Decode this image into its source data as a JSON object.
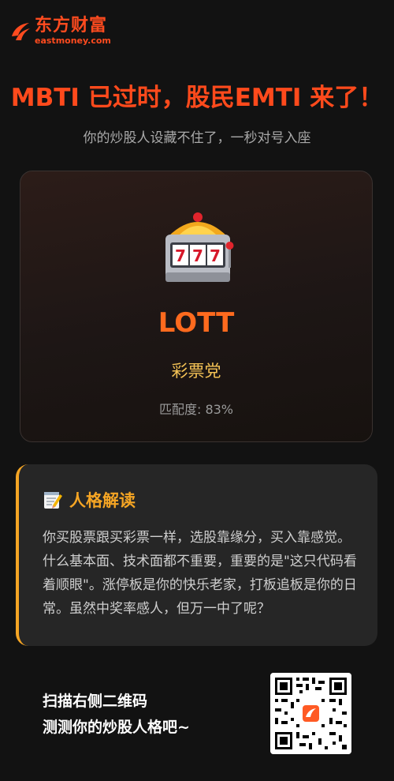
{
  "brand": {
    "name_cn": "东方财富",
    "name_en": "eastmoney.com",
    "color": "#ff4b1f"
  },
  "header": {
    "headline": "MBTI 已过时，股民EMTI 来了！",
    "subtitle": "你的炒股人设藏不住了，一秒对号入座"
  },
  "result": {
    "icon": "slot-machine-icon",
    "code": "LOTT",
    "name": "彩票党",
    "match_label": "匹配度: 83%",
    "match_value": 83
  },
  "analysis": {
    "icon": "memo-icon",
    "title": "人格解读",
    "body": "你买股票跟买彩票一样，选股靠缘分，买入靠感觉。什么基本面、技术面都不重要，重要的是\"这只代码看着顺眼\"。涨停板是你的快乐老家，打板追板是你的日常。虽然中奖率感人，但万一中了呢？"
  },
  "cta": {
    "line1": "扫描右侧二维码",
    "line2": "测测你的炒股人格吧~",
    "qr_icon": "qr-code-icon"
  },
  "colors": {
    "accent_orange": "#ff4a1c",
    "gold": "#f5a524",
    "background": "#121212"
  }
}
